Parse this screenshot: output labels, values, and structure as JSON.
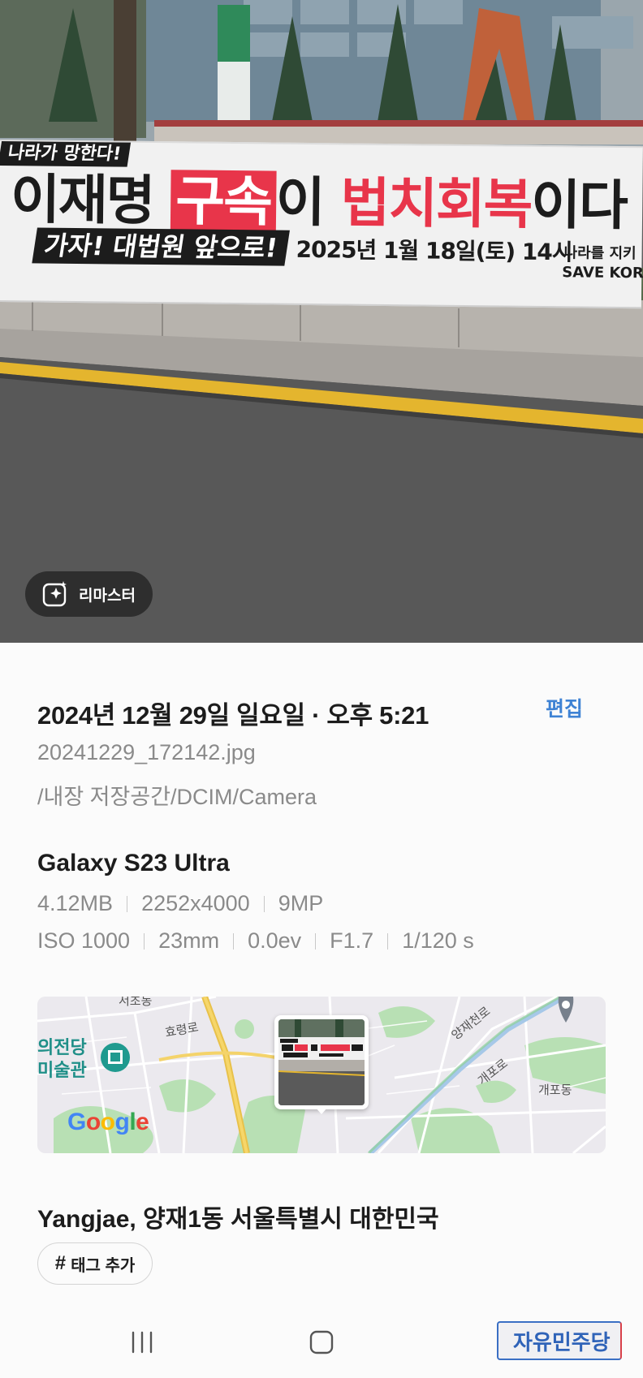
{
  "photo": {
    "banner": {
      "tag": "나라가 망한다!",
      "line1_a": "이재명 ",
      "line1_hl": "구속",
      "line1_b": "이 ",
      "line1_red": "법치회복",
      "line1_c": "이다",
      "line2": "가자! 대법원 앞으로!",
      "date": "2025년 1월 18일(토) 14시",
      "right1": "나라를 지키",
      "right2": "SAVE KOREA"
    },
    "remaster_label": "리마스터",
    "remaster_icon": "sparkle-image-icon"
  },
  "details": {
    "datetime": "2024년 12월 29일 일요일 · 오후 5:21",
    "edit_label": "편집",
    "filename": "20241229_172142.jpg",
    "path": "/내장 저장공간/DCIM/Camera",
    "model": "Galaxy S23 Ultra",
    "file_specs": [
      "4.12MB",
      "2252x4000",
      "9MP"
    ],
    "camera_specs": [
      "ISO 1000",
      "23mm",
      "0.0ev",
      "F1.7",
      "1/120 s"
    ],
    "map": {
      "labels": [
        "서초동",
        "효령로",
        "양재천로",
        "개포로",
        "개포동"
      ],
      "museum": [
        "의전당",
        "미술관"
      ],
      "attribution": "Google"
    },
    "location": "Yangjae, 양재1동 서울특별시 대한민국",
    "tag_button": "태그 추가"
  },
  "navbar": {
    "recent_icon": "recent-apps-icon",
    "home_icon": "home-icon",
    "back_icon": "back-icon"
  },
  "watermark": "자유민주당"
}
